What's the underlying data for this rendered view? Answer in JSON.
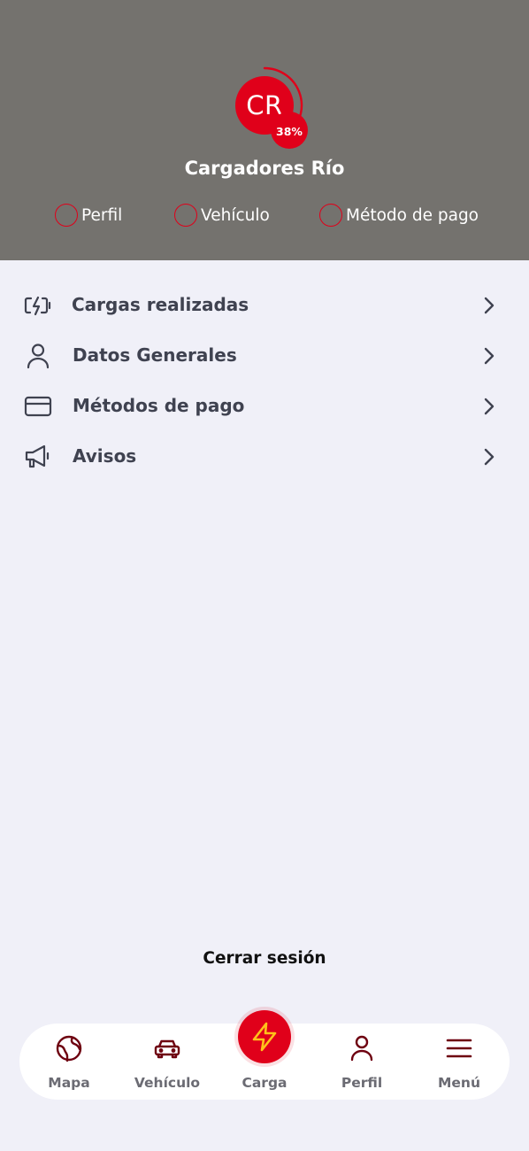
{
  "colors": {
    "header_bg": "#74726e",
    "accent": "#e0001a",
    "page_bg": "#f0f0f8",
    "nav_icon": "#6e0010",
    "bolt": "#ffc21a"
  },
  "profile": {
    "initials": "CR",
    "completion_percent": 38,
    "completion_label": "38%",
    "name": "Cargadores Río",
    "steps": [
      {
        "label": "Perfil",
        "done": false
      },
      {
        "label": "Vehículo",
        "done": false
      },
      {
        "label": "Método de pago",
        "done": false
      }
    ]
  },
  "menu": {
    "items": [
      {
        "label": "Cargas realizadas",
        "icon": "battery-charging-icon"
      },
      {
        "label": "Datos Generales",
        "icon": "user-icon"
      },
      {
        "label": "Métodos de pago",
        "icon": "credit-card-icon"
      },
      {
        "label": "Avisos",
        "icon": "megaphone-icon"
      }
    ]
  },
  "logout": {
    "label": "Cerrar sesión"
  },
  "nav": {
    "items": [
      {
        "label": "Mapa",
        "icon": "globe-icon"
      },
      {
        "label": "Vehículo",
        "icon": "car-icon"
      },
      {
        "label": "Carga",
        "icon": "lightning-icon"
      },
      {
        "label": "Perfil",
        "icon": "user-icon"
      },
      {
        "label": "Menú",
        "icon": "menu-icon"
      }
    ]
  }
}
